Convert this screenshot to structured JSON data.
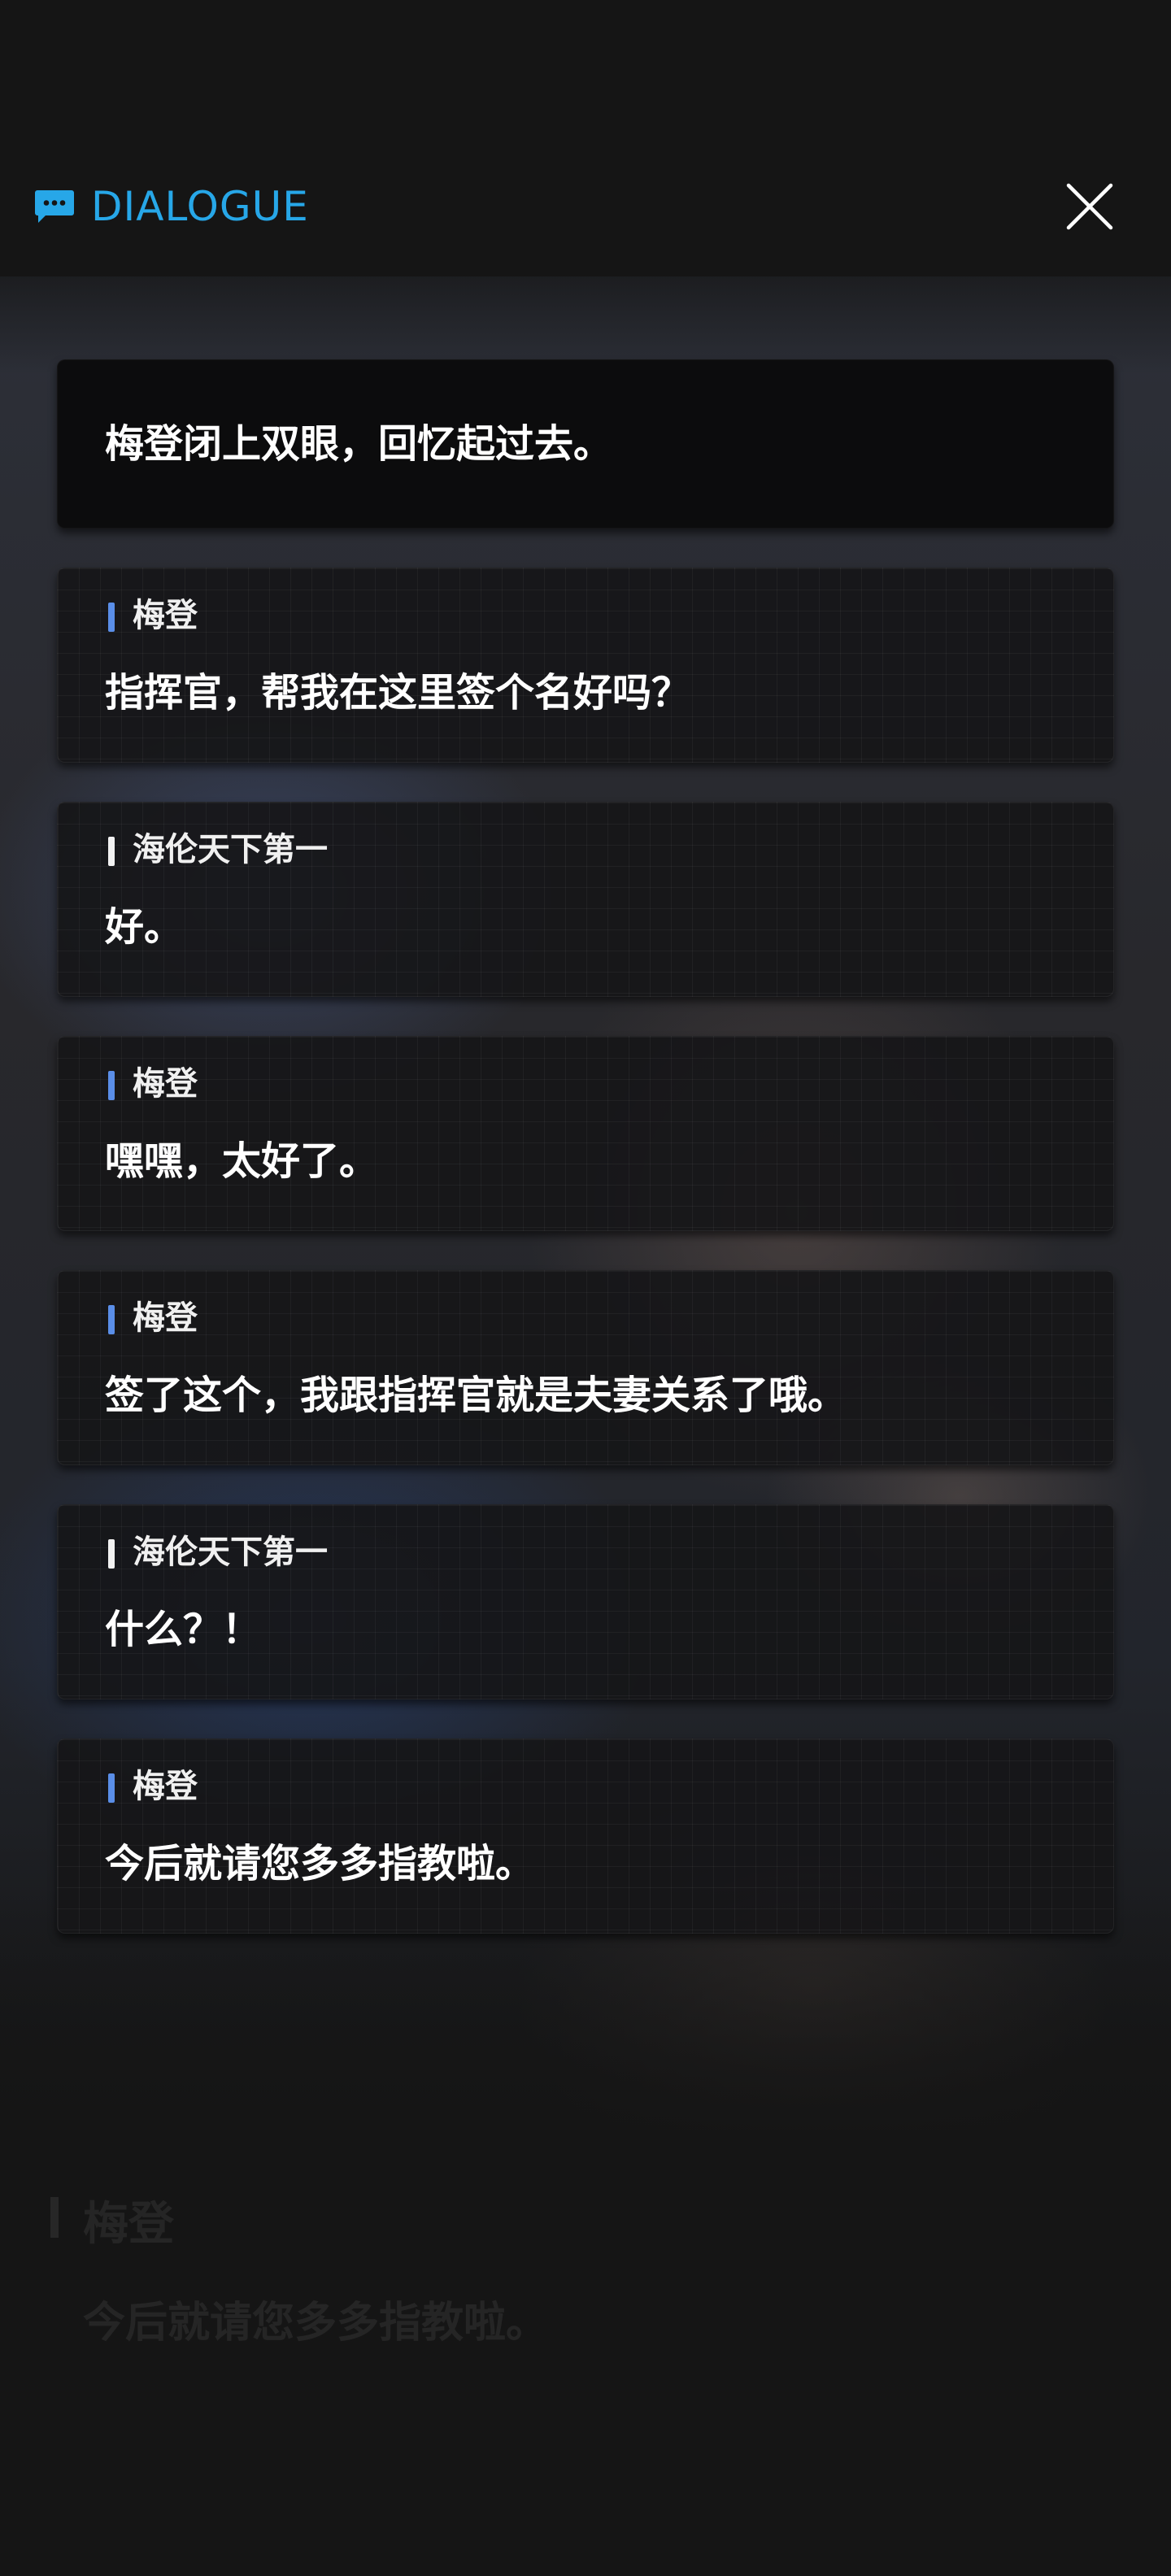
{
  "header": {
    "title": "DIALOGUE",
    "icon": "chat-bubble-icon",
    "close_icon": "close-icon",
    "accent_color": "#27a7e8"
  },
  "narration": {
    "text": "梅登闭上双眼，回忆起过去。"
  },
  "dialogue": [
    {
      "speaker": "梅登",
      "text": "指挥官，帮我在这里签个名好吗？",
      "bar_color": "blue"
    },
    {
      "speaker": "海伦天下第一",
      "text": "好。",
      "bar_color": "white"
    },
    {
      "speaker": "梅登",
      "text": "嘿嘿，太好了。",
      "bar_color": "blue"
    },
    {
      "speaker": "梅登",
      "text": "签了这个，我跟指挥官就是夫妻关系了哦。",
      "bar_color": "blue"
    },
    {
      "speaker": "海伦天下第一",
      "text": "什么？！",
      "bar_color": "white"
    },
    {
      "speaker": "梅登",
      "text": "今后就请您多多指教啦。",
      "bar_color": "blue"
    }
  ],
  "background_dialogue": {
    "speaker": "梅登",
    "text": "今后就请您多多指教啦。"
  },
  "colors": {
    "background": "#151515",
    "speaker_bar_blue": "#5a8ee8",
    "speaker_bar_white": "#f2f2f2"
  }
}
